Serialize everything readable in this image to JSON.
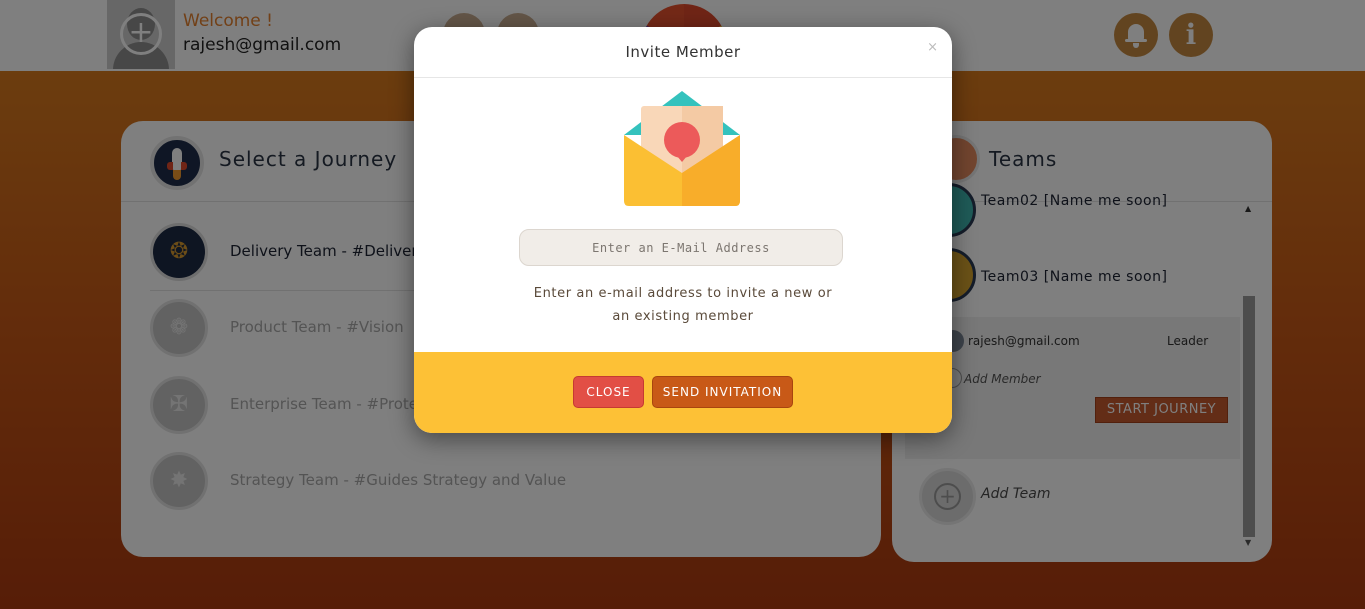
{
  "header": {
    "welcome": "Welcome !",
    "email": "rajesh@gmail.com"
  },
  "journeys": {
    "title": "Select a Journey",
    "items": [
      {
        "label": "Delivery Team - #Deliver",
        "icon": "delivery-emblem-icon"
      },
      {
        "label": "Product Team - #Vision",
        "icon": "rebel-emblem-icon"
      },
      {
        "label": "Enterprise Team - #Prote",
        "icon": "jedi-emblem-icon"
      },
      {
        "label": "Strategy Team - #Guides Strategy and Value",
        "icon": "empire-emblem-icon"
      }
    ]
  },
  "teams": {
    "title": "Teams",
    "items": [
      {
        "label": "Team02 [Name me soon]"
      },
      {
        "label": "Team03 [Name me soon]"
      }
    ],
    "member": {
      "email": "rajesh@gmail.com",
      "role": "Leader"
    },
    "add_member": "Add Member",
    "start_journey": "START JOURNEY",
    "add_team": "Add Team"
  },
  "modal": {
    "title": "Invite Member",
    "close_x": "×",
    "email_placeholder": "Enter an E-Mail Address",
    "helper_line1": "Enter an e-mail address to invite a new or",
    "helper_line2": "an existing member",
    "close_button": "CLOSE",
    "send_button": "SEND INVITATION"
  },
  "colors": {
    "accent_orange": "#c85917",
    "footer_yellow": "#fdc136",
    "close_red": "#e24f45"
  }
}
